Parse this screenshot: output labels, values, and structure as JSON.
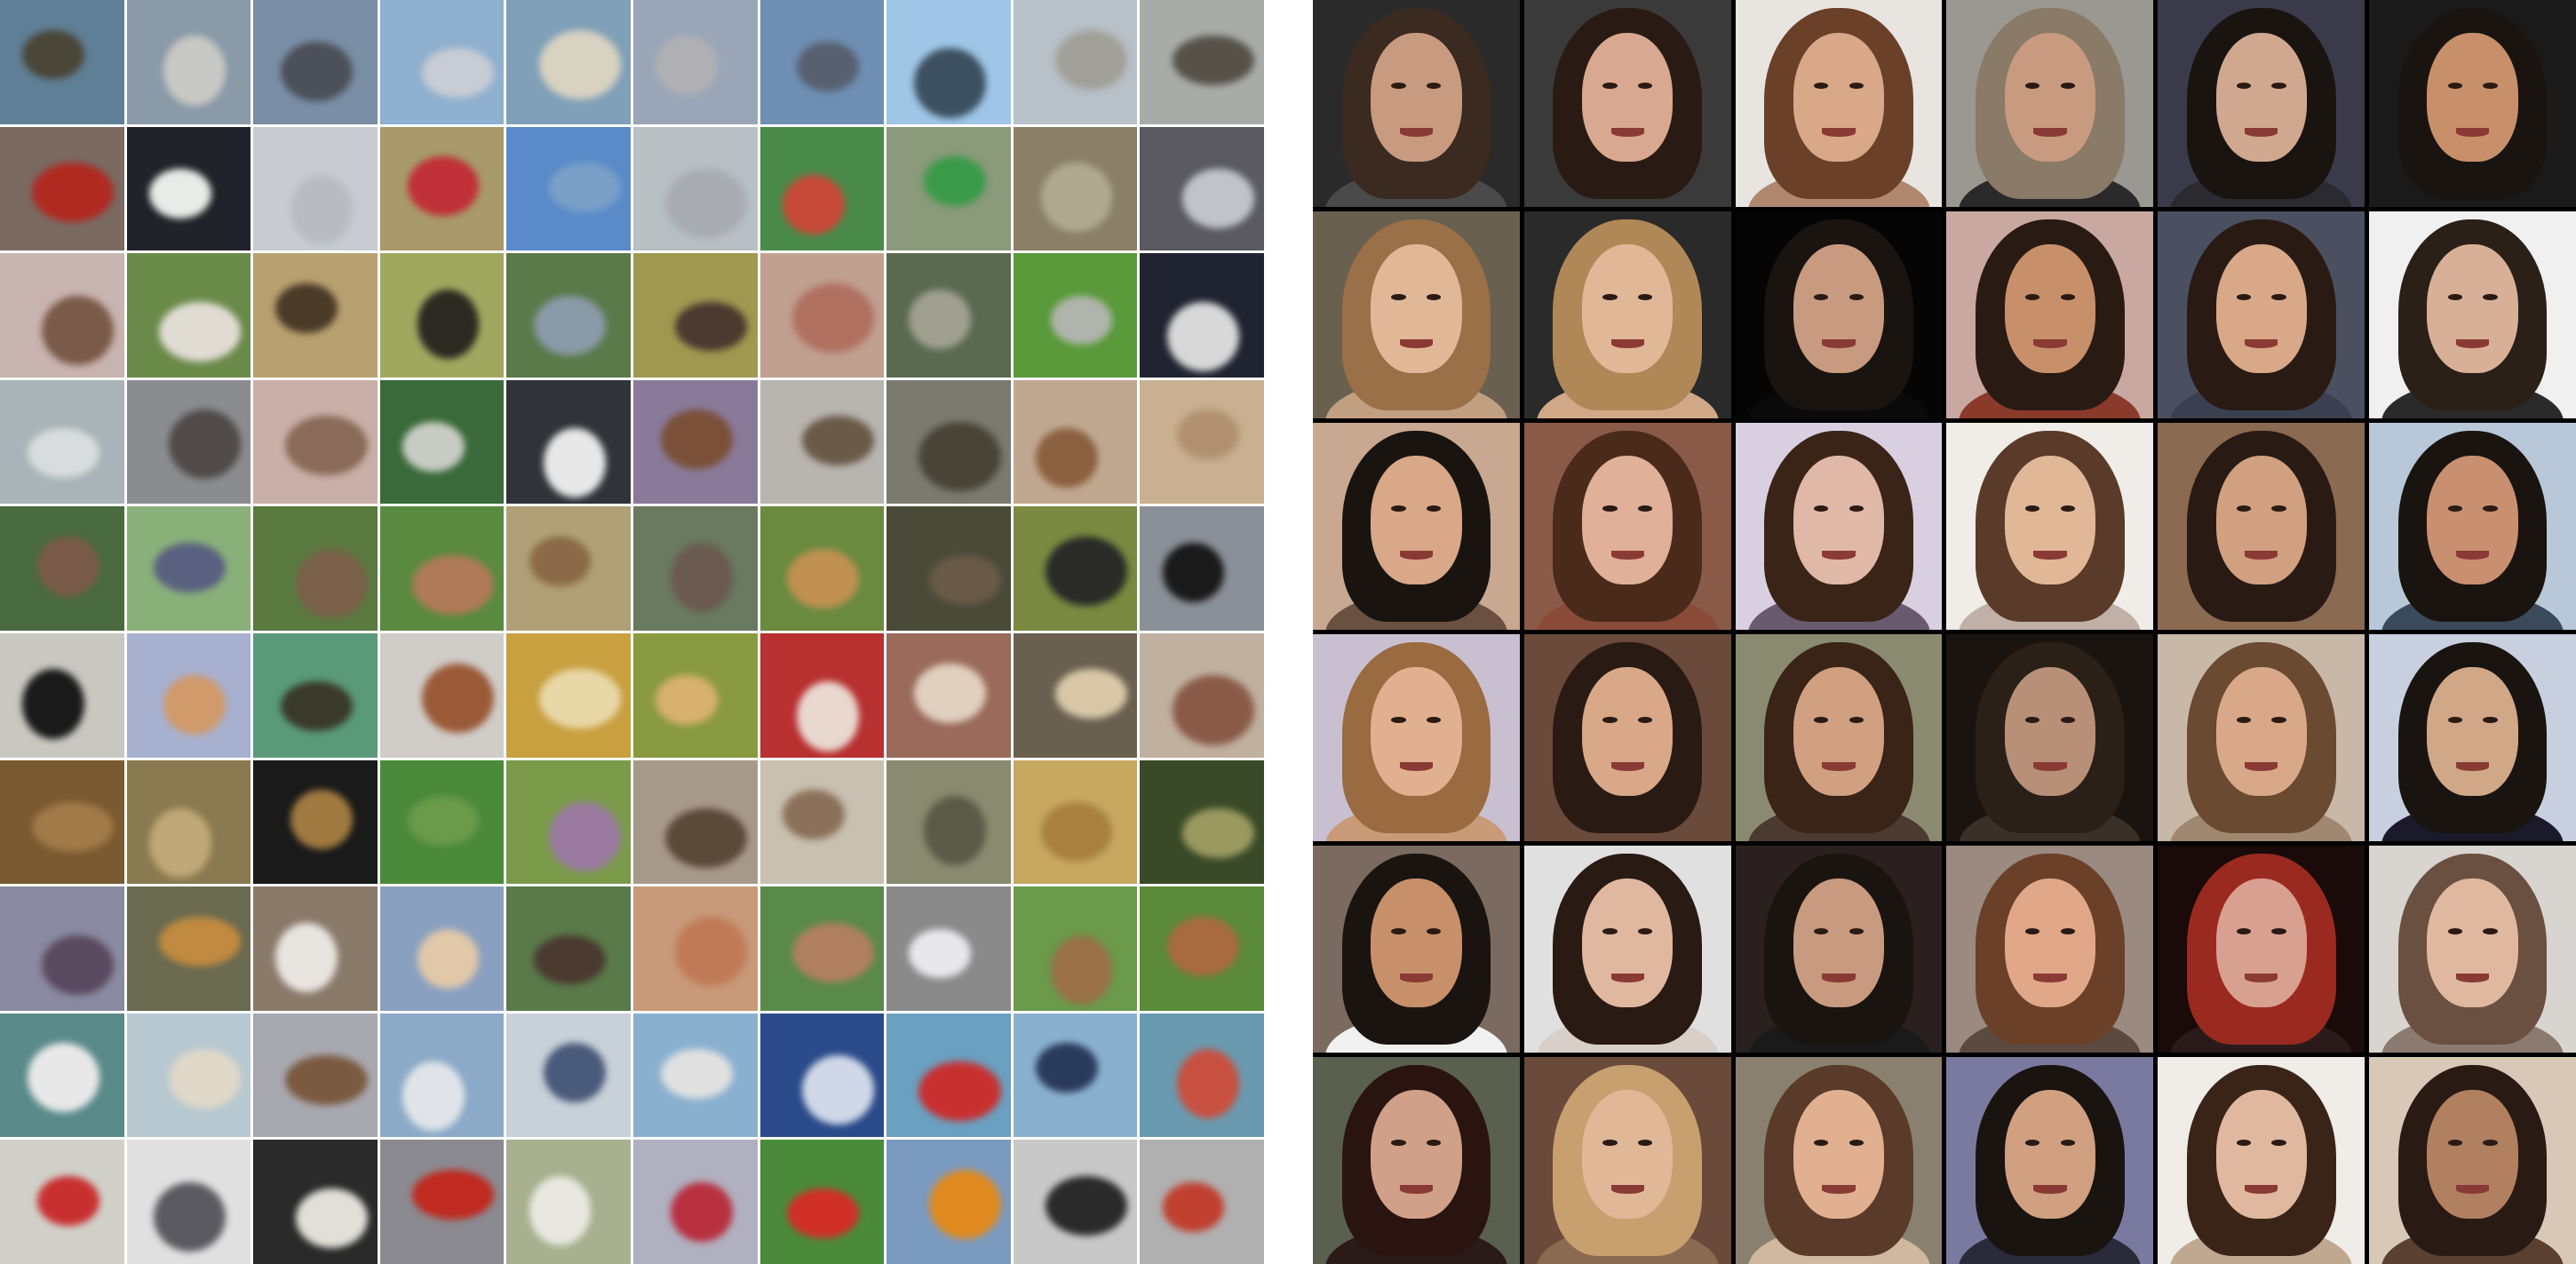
{
  "left_grid": {
    "rows": 10,
    "cols": 10,
    "row_colors": [
      {
        "bg": [
          "#5f7f96",
          "#8a9aa8",
          "#7a8ea6",
          "#8fb0cf",
          "#7fa0b8",
          "#9aa6b8",
          "#6e8fb3",
          "#9fc6e6",
          "#b8c0c8",
          "#a8aca8"
        ],
        "fg": [
          "#4a4638",
          "#c8c8c4",
          "#4c5058",
          "#c8ccd4",
          "#d8d2c0",
          "#b0b0b4",
          "#586070",
          "#3c5060",
          "#a0a098",
          "#56524a"
        ]
      },
      {
        "bg": [
          "#7a6a62",
          "#20242a",
          "#c8ccd0",
          "#a89a6a",
          "#5a8ac8",
          "#b8c0c4",
          "#4a8a4a",
          "#8a9a7a",
          "#8a8068",
          "#5a5a60"
        ],
        "fg": [
          "#b02a22",
          "#e8ece8",
          "#b8bcc0",
          "#c03038",
          "#7aa0c8",
          "#a8acb0",
          "#c84a38",
          "#3a9a4a",
          "#b0a890",
          "#c0c4c8"
        ]
      },
      {
        "bg": [
          "#c8b4b0",
          "#6a8a4a",
          "#b8a070",
          "#a0a860",
          "#5a7a4a",
          "#a09850",
          "#c0a090",
          "#5a6a50",
          "#5a9a3a",
          "#202430"
        ],
        "fg": [
          "#7a5a48",
          "#e0dcd4",
          "#4a3a28",
          "#2a2a22",
          "#8a9aa8",
          "#4a3a30",
          "#b07060",
          "#a0a090",
          "#b0b4ac",
          "#d8d8d8"
        ]
      },
      {
        "bg": [
          "#a8b4b8",
          "#8a8c90",
          "#c8b0a8",
          "#3a6a3a",
          "#303438",
          "#8a7a9a",
          "#b8b4b0",
          "#7a7a70",
          "#c0a890",
          "#c8b090"
        ],
        "fg": [
          "#d8dcdc",
          "#504a48",
          "#8a6a58",
          "#c8ccc4",
          "#e8e8e8",
          "#7a5038",
          "#6a5a48",
          "#4a4438",
          "#8a6040",
          "#b09070"
        ]
      },
      {
        "bg": [
          "#4a6a40",
          "#8ab07a",
          "#5a7a40",
          "#5a8a40",
          "#b0a078",
          "#6a7a60",
          "#6a8a40",
          "#4a4a38",
          "#7a8a40",
          "#8a9098"
        ],
        "fg": [
          "#7a5a48",
          "#5a6080",
          "#7a6048",
          "#b07a58",
          "#8a6a48",
          "#6a5a50",
          "#c09050",
          "#6a5a48",
          "#2a2a28",
          "#1a1a1a"
        ]
      },
      {
        "bg": [
          "#c8c8c0",
          "#a8b0d0",
          "#5a9a7a",
          "#d0ccc8",
          "#c8a040",
          "#8a9a40",
          "#b83030",
          "#9a6a5a",
          "#6a6050",
          "#c0b0a0"
        ],
        "fg": [
          "#1a1a1a",
          "#d09a6a",
          "#3a3a2a",
          "#9a5a38",
          "#e8d8a8",
          "#d8b070",
          "#e8d8d0",
          "#e0d0c0",
          "#d8c8a8",
          "#8a5a48"
        ]
      },
      {
        "bg": [
          "#7a5a30",
          "#8a7a50",
          "#1a1a1a",
          "#4a8a3a",
          "#7a9a4a",
          "#a89a8a",
          "#c8c0b0",
          "#8a8a70",
          "#c8a860",
          "#3a4a28"
        ],
        "fg": [
          "#a07a48",
          "#c0a878",
          "#a07a40",
          "#6a9a4a",
          "#9a7aa0",
          "#5a4a3a",
          "#8a7058",
          "#5a5a48",
          "#a88040",
          "#9a9a60"
        ]
      },
      {
        "bg": [
          "#8a8aa0",
          "#6a6a50",
          "#8a7a6a",
          "#8aa0c0",
          "#5a7a4a",
          "#c89a7a",
          "#5a8a4a",
          "#8a8a8a",
          "#6a9a4a",
          "#5a8a3a"
        ],
        "fg": [
          "#5a4a60",
          "#c08a40",
          "#e8e4e0",
          "#e0c8a8",
          "#4a3a30",
          "#c07a58",
          "#b08060",
          "#e8e8ec",
          "#9a7048",
          "#a86a40"
        ]
      },
      {
        "bg": [
          "#5a8a8a",
          "#b8c8d0",
          "#a8a8b0",
          "#8aaac8",
          "#c8d0d8",
          "#8ab0d0",
          "#2a4a8a",
          "#6aa0c0",
          "#8ab0d0",
          "#6a9ab0"
        ],
        "fg": [
          "#e8e8e8",
          "#e0d8c8",
          "#7a5a40",
          "#e0e4e8",
          "#4a5a7a",
          "#e0e0e0",
          "#d0d8e8",
          "#c83030",
          "#2a3a5a",
          "#c85040"
        ]
      },
      {
        "bg": [
          "#d0d0c8",
          "#e0e0e0",
          "#2a2a2a",
          "#8a8a90",
          "#a8b090",
          "#b0b0c0",
          "#4a8a3a",
          "#7a9ac0",
          "#c8c8c8",
          "#b0b0b0"
        ],
        "fg": [
          "#c83030",
          "#5a5a60",
          "#e0e0d8",
          "#c02a20",
          "#e8e8e0",
          "#b83040",
          "#d03028",
          "#e08a20",
          "#2a2a2a",
          "#c04030"
        ]
      }
    ]
  },
  "right_grid": {
    "rows": 6,
    "cols": 6,
    "tiles": [
      {
        "bg": "#2a2a2a",
        "hair": "#3a2a20",
        "skin": "#c89a80",
        "cloth": "#4a4a4a"
      },
      {
        "bg": "#3a3a3a",
        "hair": "#2a1a14",
        "skin": "#d8a890",
        "cloth": "#3a3a3a"
      },
      {
        "bg": "#e8e4e0",
        "hair": "#6a4028",
        "skin": "#d8a888",
        "cloth": "#b08870"
      },
      {
        "bg": "#9a9890",
        "hair": "#8a7a68",
        "skin": "#c89a80",
        "cloth": "#2a2a2a"
      },
      {
        "bg": "#3a3a4a",
        "hair": "#1a1410",
        "skin": "#d0a890",
        "cloth": "#2a2a30"
      },
      {
        "bg": "#1a1a1a",
        "hair": "#1a1410",
        "skin": "#c8906a",
        "cloth": "#1a1a1a"
      },
      {
        "bg": "#6a6050",
        "hair": "#9a7048",
        "skin": "#e0b898",
        "cloth": "#c0a080"
      },
      {
        "bg": "#2a2a2a",
        "hair": "#b08858",
        "skin": "#e0b898",
        "cloth": "#d0a888"
      },
      {
        "bg": "#050505",
        "hair": "#1a1410",
        "skin": "#c89a80",
        "cloth": "#0a0a0a"
      },
      {
        "bg": "#c8a8a0",
        "hair": "#2a1a14",
        "skin": "#c8906a",
        "cloth": "#8a3a2a"
      },
      {
        "bg": "#4a5060",
        "hair": "#2a1a14",
        "skin": "#d8a888",
        "cloth": "#3a4050"
      },
      {
        "bg": "#f0f0f0",
        "hair": "#2a2018",
        "skin": "#d8b098",
        "cloth": "#2a2a2a"
      },
      {
        "bg": "#c8a890",
        "hair": "#1a1410",
        "skin": "#d8a888",
        "cloth": "#6a5040"
      },
      {
        "bg": "#8a5a48",
        "hair": "#4a2a1a",
        "skin": "#e0b098",
        "cloth": "#8a4a38"
      },
      {
        "bg": "#d8d0e0",
        "hair": "#3a2418",
        "skin": "#e0b8a8",
        "cloth": "#6a5a70"
      },
      {
        "bg": "#f0ece8",
        "hair": "#5a3a28",
        "skin": "#e0b898",
        "cloth": "#c0b0a8"
      },
      {
        "bg": "#8a6a50",
        "hair": "#2a1a14",
        "skin": "#d0a080",
        "cloth": "#8a6a50"
      },
      {
        "bg": "#b8c8d8",
        "hair": "#1a1410",
        "skin": "#c89070",
        "cloth": "#3a4a5a"
      },
      {
        "bg": "#c8c0d0",
        "hair": "#9a6a40",
        "skin": "#e0b090",
        "cloth": "#c89a78"
      },
      {
        "bg": "#6a4a3a",
        "hair": "#2a1a14",
        "skin": "#d8a888",
        "cloth": "#6a4a3a"
      },
      {
        "bg": "#8a8a70",
        "hair": "#3a2418",
        "skin": "#d0a080",
        "cloth": "#4a3a30"
      },
      {
        "bg": "#1a1410",
        "hair": "#2a2018",
        "skin": "#b89078",
        "cloth": "#3a3028"
      },
      {
        "bg": "#c8b8a8",
        "hair": "#6a4a30",
        "skin": "#d8a888",
        "cloth": "#a08870"
      },
      {
        "bg": "#c8d0e0",
        "hair": "#1a1410",
        "skin": "#d0a888",
        "cloth": "#1a1a2a"
      },
      {
        "bg": "#7a6a60",
        "hair": "#1a1410",
        "skin": "#c8906a",
        "cloth": "#f0f0f0"
      },
      {
        "bg": "#e0e0e0",
        "hair": "#2a1a14",
        "skin": "#e0b8a0",
        "cloth": "#d8d0c8"
      },
      {
        "bg": "#2a2020",
        "hair": "#1a1410",
        "skin": "#c89a80",
        "cloth": "#1a1a1a"
      },
      {
        "bg": "#9a8a80",
        "hair": "#6a4028",
        "skin": "#e0a888",
        "cloth": "#5a4a40"
      },
      {
        "bg": "#1a0a0a",
        "hair": "#9a2a20",
        "skin": "#d8a090",
        "cloth": "#2a1a1a"
      },
      {
        "bg": "#d8d4d0",
        "hair": "#6a5040",
        "skin": "#e0b8a0",
        "cloth": "#8a7a70"
      },
      {
        "bg": "#5a6050",
        "hair": "#2a1410",
        "skin": "#d0a088",
        "cloth": "#2a1a18"
      },
      {
        "bg": "#6a4a3a",
        "hair": "#c8a070",
        "skin": "#e0b898",
        "cloth": "#8a6a50"
      },
      {
        "bg": "#8a8070",
        "hair": "#5a3a28",
        "skin": "#e0b090",
        "cloth": "#d0b8a0"
      },
      {
        "bg": "#7a7aa0",
        "hair": "#1a1410",
        "skin": "#d0a080",
        "cloth": "#2a2a3a"
      },
      {
        "bg": "#f0ece8",
        "hair": "#3a2418",
        "skin": "#e0b8a0",
        "cloth": "#c0a890"
      },
      {
        "bg": "#d8c8b8",
        "hair": "#2a1a14",
        "skin": "#b08060",
        "cloth": "#5a4030"
      }
    ]
  }
}
